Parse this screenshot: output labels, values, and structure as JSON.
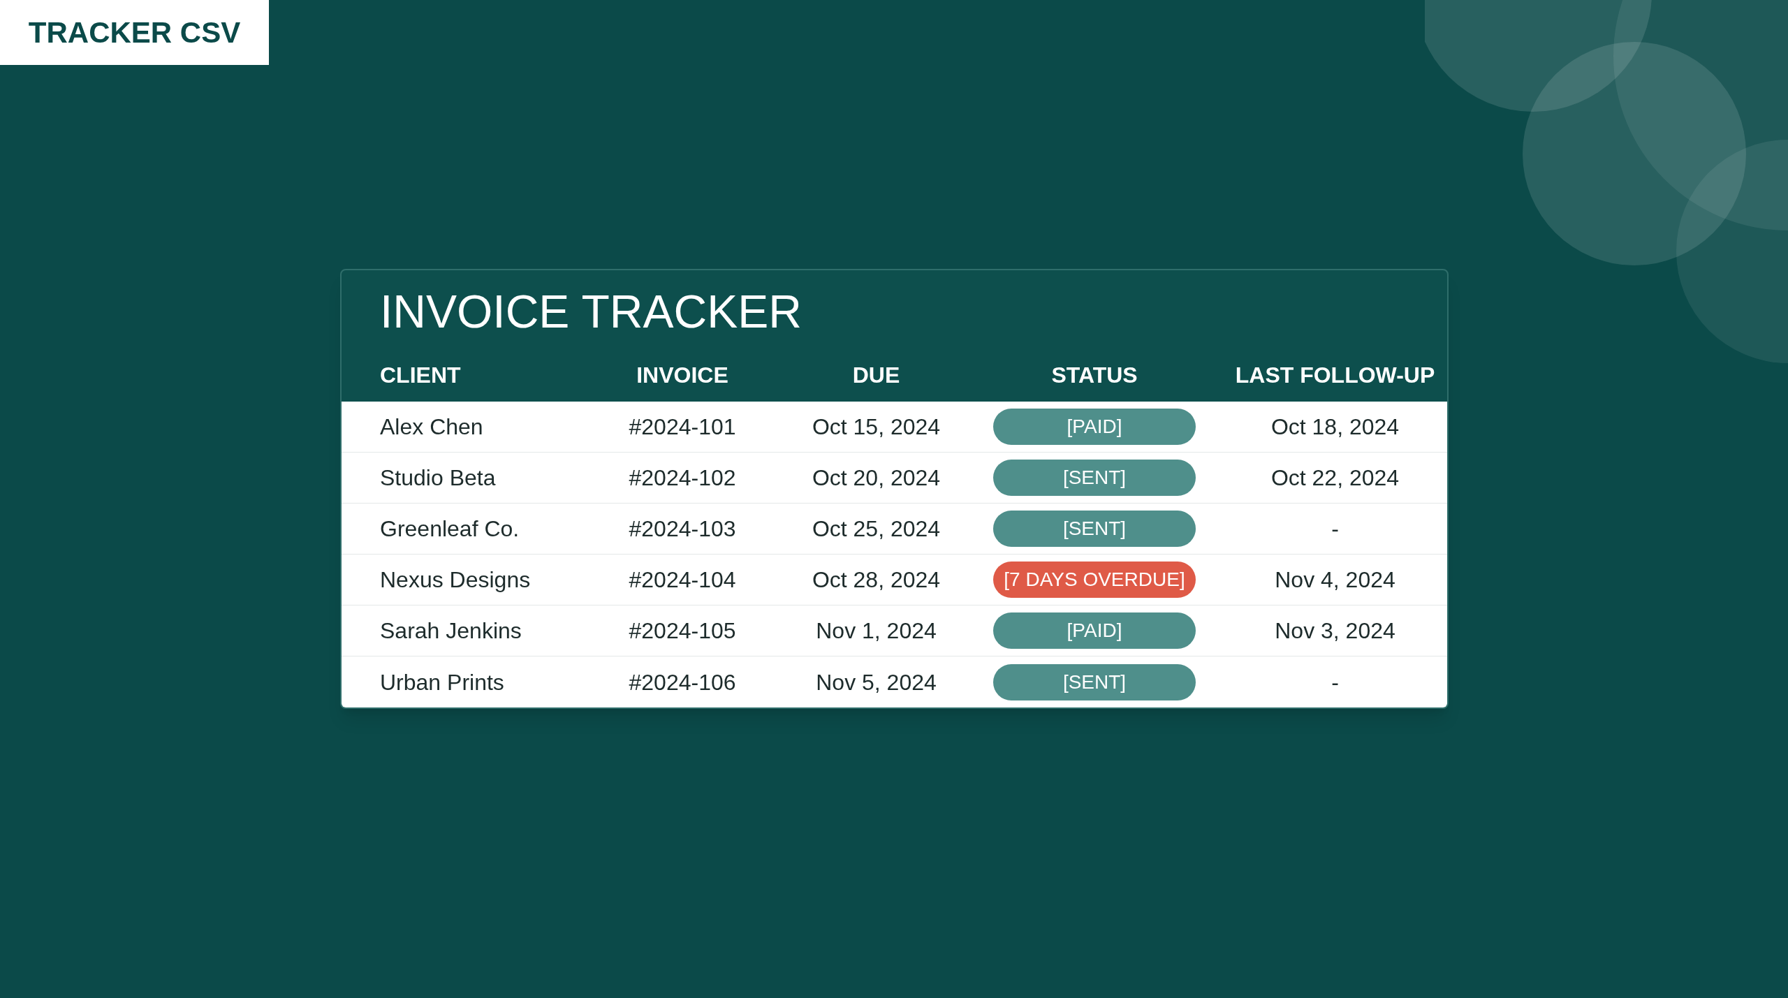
{
  "corner_label": "TRACKER CSV",
  "card": {
    "title": "INVOICE TRACKER",
    "columns": [
      "CLIENT",
      "INVOICE",
      "DUE",
      "STATUS",
      "LAST FOLLOW-UP"
    ],
    "rows": [
      {
        "client": "Alex Chen",
        "invoice": "#2024-101",
        "due": "Oct 15, 2024",
        "status": {
          "text": "[PAID]",
          "kind": "normal"
        },
        "last_follow_up": "Oct 18, 2024"
      },
      {
        "client": "Studio Beta",
        "invoice": "#2024-102",
        "due": "Oct 20, 2024",
        "status": {
          "text": "[SENT]",
          "kind": "normal"
        },
        "last_follow_up": "Oct 22, 2024"
      },
      {
        "client": "Greenleaf Co.",
        "invoice": "#2024-103",
        "due": "Oct 25, 2024",
        "status": {
          "text": "[SENT]",
          "kind": "normal"
        },
        "last_follow_up": "-"
      },
      {
        "client": "Nexus Designs",
        "invoice": "#2024-104",
        "due": "Oct 28, 2024",
        "status": {
          "text": "[7 DAYS OVERDUE]",
          "kind": "alert"
        },
        "last_follow_up": "Nov 4, 2024"
      },
      {
        "client": "Sarah Jenkins",
        "invoice": "#2024-105",
        "due": "Nov 1, 2024",
        "status": {
          "text": "[PAID]",
          "kind": "normal"
        },
        "last_follow_up": "Nov 3, 2024"
      },
      {
        "client": "Urban Prints",
        "invoice": "#2024-106",
        "due": "Nov 5, 2024",
        "status": {
          "text": "[SENT]",
          "kind": "normal"
        },
        "last_follow_up": "-"
      }
    ]
  }
}
